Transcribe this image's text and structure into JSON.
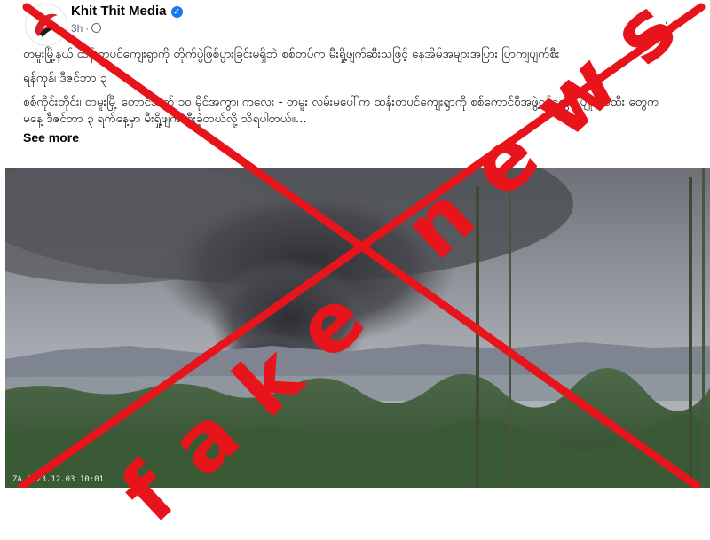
{
  "post": {
    "page_name": "Khit Thit Media",
    "verified_icon": "verified-badge-icon",
    "time": "3h",
    "audience_icon": "globe-icon",
    "menu_label": "...",
    "headline": "တမူးမြို့နယ် ထန်းတပင်ကျေးရွာကို တိုက်ပွဲဖြစ်ပွားခြင်းမရှိဘဲ စစ်တပ်က  မီးရှို့ဖျက်ဆီးသဖြင့် နေအိမ်အများအပြား ပြာကျပျက်စီး",
    "dateline": "ရန်ကုန်၊  ဒီဇင်ဘာ ၃",
    "body": "စစ်ကိုင်းတိုင်း၊ တမူးမြို့ တောင်ဘက် ၁၀ မိုင်အကွာ၊ ကလေး - တမူး လမ်းမပေါ်က ထန်းတပင်ကျေးရွာကို စစ်ကောင်စီအဖွဲ့ဝင်တွေနဲ့ ပျူစောထီး တွေက မနေ့ ဒီဇင်ဘာ ၃ ရက်နေ့မှာ မီးရှို့ဖျက်ဆီးခဲ့တယ်လို့ သိရပါတယ်။...",
    "see_more": "See more",
    "photo_timestamp": "ZA  2023.12.03 10:01"
  },
  "overlay": {
    "stamp": "fake news",
    "color": "#e8141b"
  }
}
